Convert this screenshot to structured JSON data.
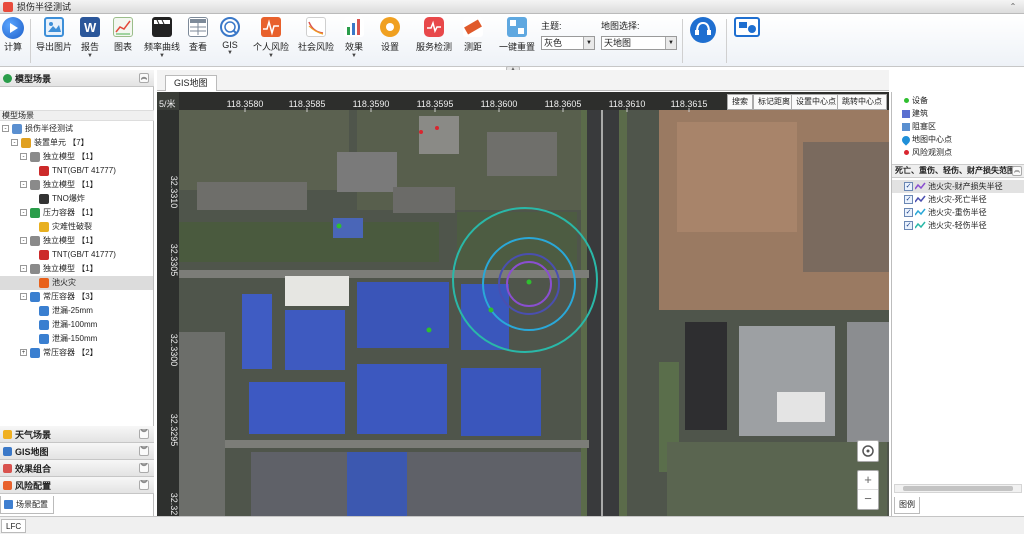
{
  "window": {
    "title": "损伤半径测试"
  },
  "toolbar": {
    "buttons": [
      {
        "label": "计算",
        "icon": "play-icon",
        "color": "#2a6fd6"
      },
      {
        "label": "导出图片",
        "icon": "export-image-icon",
        "color": "#3d8fd8"
      },
      {
        "label": "报告",
        "icon": "word-report-icon",
        "color": "#2b579a"
      },
      {
        "label": "图表",
        "icon": "chart-icon",
        "color": "#4caf50"
      },
      {
        "label": "频率曲线",
        "icon": "clapper-icon",
        "color": "#333333"
      },
      {
        "label": "查看",
        "icon": "table-view-icon",
        "color": "#7d8a99"
      },
      {
        "label": "GIS",
        "icon": "gis-icon",
        "color": "#3a78c8"
      },
      {
        "label": "个人风险",
        "icon": "personal-risk-icon",
        "color": "#e8612c"
      },
      {
        "label": "社会风险",
        "icon": "social-risk-icon",
        "color": "#d9534f"
      },
      {
        "label": "效果",
        "icon": "effect-bars-icon",
        "color": "#d9534f"
      },
      {
        "label": "设置",
        "icon": "gear-icon",
        "color": "#f0a020"
      },
      {
        "label": "服务检测",
        "icon": "service-check-icon",
        "color": "#e8484a"
      },
      {
        "label": "测距",
        "icon": "ruler-icon",
        "color": "#e05a2b"
      },
      {
        "label": "一键重置",
        "icon": "puzzle-reset-icon",
        "color": "#5fa8e0"
      }
    ],
    "theme_label": "主题:",
    "theme_value": "灰色",
    "map_label": "地图选择:",
    "map_value": "天地图",
    "support_icon": "support-headset-icon",
    "card_icon": "card-icon"
  },
  "left_panel": {
    "header": "模型场景",
    "subheader": "模型场景",
    "tree": [
      {
        "label": "损伤半径测试",
        "level": 0,
        "expander": "-",
        "icon": "cloud-icon",
        "color": "#5a8fd0"
      },
      {
        "label": "装置单元 【7】",
        "level": 1,
        "expander": "-",
        "icon": "unit-icon",
        "color": "#e0a020"
      },
      {
        "label": "独立模型 【1】",
        "level": 2,
        "expander": "-",
        "icon": "grid-icon",
        "color": "#8a8a8a"
      },
      {
        "label": "TNT(GB/T 41777)",
        "level": 3,
        "expander": "",
        "icon": "dynamite-icon",
        "color": "#cc2a2a"
      },
      {
        "label": "独立模型 【1】",
        "level": 2,
        "expander": "-",
        "icon": "grid-icon",
        "color": "#8a8a8a"
      },
      {
        "label": "TNO爆炸",
        "level": 3,
        "expander": "",
        "icon": "bomb-icon",
        "color": "#333333"
      },
      {
        "label": "压力容器 【1】",
        "level": 2,
        "expander": "-",
        "icon": "pressure-vessel-icon",
        "color": "#2a9d4a"
      },
      {
        "label": "灾难性破裂",
        "level": 3,
        "expander": "",
        "icon": "rupture-icon",
        "color": "#e8b020"
      },
      {
        "label": "独立模型 【1】",
        "level": 2,
        "expander": "-",
        "icon": "grid-icon",
        "color": "#8a8a8a"
      },
      {
        "label": "TNT(GB/T 41777)",
        "level": 3,
        "expander": "",
        "icon": "dynamite-icon",
        "color": "#cc2a2a"
      },
      {
        "label": "独立模型 【1】",
        "level": 2,
        "expander": "-",
        "icon": "grid-icon",
        "color": "#8a8a8a"
      },
      {
        "label": "池火灾",
        "level": 3,
        "expander": "",
        "icon": "pool-fire-icon",
        "color": "#e8621c",
        "selected": true
      },
      {
        "label": "常压容器 【3】",
        "level": 2,
        "expander": "-",
        "icon": "tank-icon",
        "color": "#3a7fd0"
      },
      {
        "label": "泄漏-25mm",
        "level": 3,
        "expander": "",
        "icon": "leak-icon",
        "color": "#3a7fd0"
      },
      {
        "label": "泄漏-100mm",
        "level": 3,
        "expander": "",
        "icon": "leak-icon",
        "color": "#3a7fd0"
      },
      {
        "label": "泄漏-150mm",
        "level": 3,
        "expander": "",
        "icon": "leak-icon",
        "color": "#3a7fd0"
      },
      {
        "label": "常压容器 【2】",
        "level": 2,
        "expander": "+",
        "icon": "tank-icon",
        "color": "#3a7fd0"
      }
    ],
    "sections": [
      {
        "label": "天气场景",
        "icon": "weather-icon",
        "color": "#f0b020"
      },
      {
        "label": "GIS地图",
        "icon": "gis-map-icon",
        "color": "#3a78c8"
      },
      {
        "label": "效果组合",
        "icon": "effect-combo-icon",
        "color": "#d9534f"
      },
      {
        "label": "风险配置",
        "icon": "risk-config-icon",
        "color": "#e8612c"
      }
    ],
    "bottom_tab": "场景配置"
  },
  "center": {
    "tab": "GIS地图",
    "map_tools": [
      "搜索",
      "标记距离",
      "设置中心点",
      "跳转中心点"
    ],
    "lon_ticks": [
      "118.3580",
      "118.3585",
      "118.3590",
      "118.3595",
      "118.3600",
      "118.3605",
      "118.3610",
      "118.3615"
    ],
    "lat_ticks": [
      "32.3310",
      "32.3305",
      "32.3300",
      "32.3295",
      "32.32"
    ],
    "scale_label": "5/米",
    "zoom_in": "+",
    "zoom_out": "−"
  },
  "right_panel": {
    "legend": [
      {
        "label": "设备",
        "symbol": "device-dot-icon",
        "color": "#2fbf2f"
      },
      {
        "label": "建筑",
        "symbol": "building-icon",
        "color": "#5a6fd0"
      },
      {
        "label": "阻塞区",
        "symbol": "block-zone-icon",
        "color": "#5a8fd0"
      },
      {
        "label": "地图中心点",
        "symbol": "map-pin-icon",
        "color": "#1f8fd8"
      },
      {
        "label": "风险观测点",
        "symbol": "observe-dot-icon",
        "color": "#d9262f"
      }
    ],
    "range_header": "死亡、重伤、轻伤、财产损失范围",
    "layers": [
      {
        "label": "池火灾-财产损失半径",
        "checked": true,
        "color": "#8a4fd0",
        "selected": true
      },
      {
        "label": "池火灾-死亡半径",
        "checked": true,
        "color": "#4a4fb0"
      },
      {
        "label": "池火灾-重伤半径",
        "checked": true,
        "color": "#2aa8d8"
      },
      {
        "label": "池火灾-轻伤半径",
        "checked": true,
        "color": "#2ab8a8"
      }
    ],
    "bottom_tab": "图例"
  },
  "status": {
    "text": "LFC"
  }
}
